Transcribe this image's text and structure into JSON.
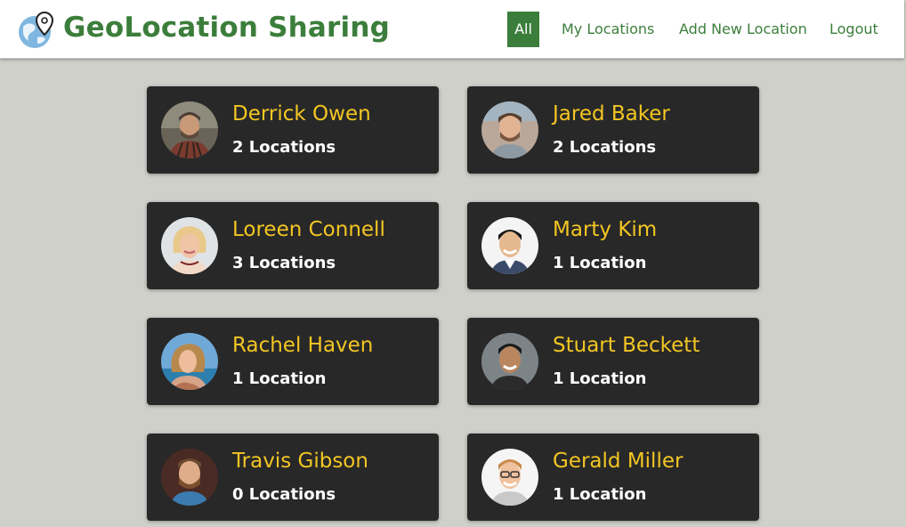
{
  "header": {
    "app_title": "GeoLocation Sharing",
    "logo_icon": "globe-pin-icon",
    "colors": {
      "brand_green": "#3b7e3b",
      "header_bg": "#ffffff"
    }
  },
  "nav": {
    "items": [
      {
        "label": "All",
        "active": true
      },
      {
        "label": "My Locations",
        "active": false
      },
      {
        "label": "Add New Location",
        "active": false
      },
      {
        "label": "Logout",
        "active": false
      }
    ]
  },
  "users": [
    {
      "name": "Derrick Owen",
      "locations": "2 Locations"
    },
    {
      "name": "Jared Baker",
      "locations": "2 Locations"
    },
    {
      "name": "Loreen Connell",
      "locations": "3 Locations"
    },
    {
      "name": "Marty Kim",
      "locations": "1 Location"
    },
    {
      "name": "Rachel Haven",
      "locations": "1 Location"
    },
    {
      "name": "Stuart Beckett",
      "locations": "1 Location"
    },
    {
      "name": "Travis Gibson",
      "locations": "0 Locations"
    },
    {
      "name": "Gerald Miller",
      "locations": "1 Location"
    }
  ],
  "colors": {
    "page_bg": "#d0d0cb",
    "card_bg": "#282828",
    "name_color": "#f3c623",
    "count_color": "#ffffff"
  }
}
